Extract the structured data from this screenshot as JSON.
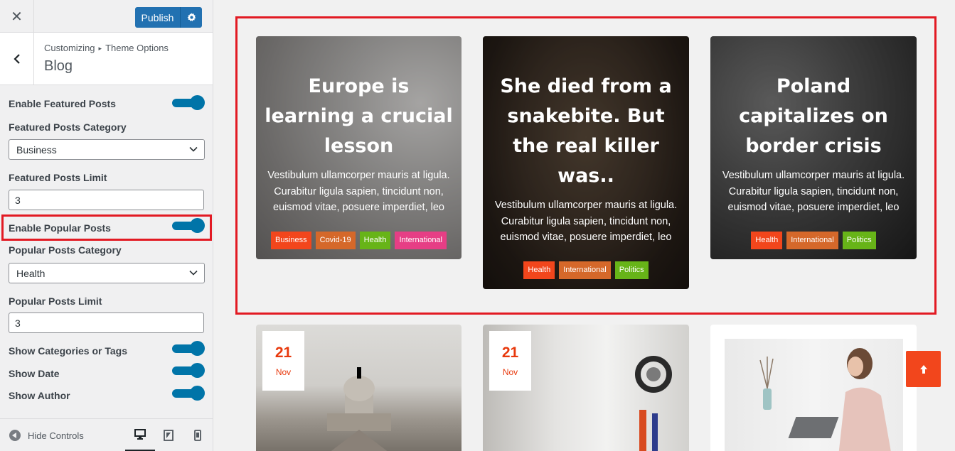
{
  "topbar": {
    "close_icon": "close-icon",
    "publish_label": "Publish",
    "settings_icon": "gear-icon"
  },
  "section": {
    "breadcrumb_root": "Customizing",
    "breadcrumb_parent": "Theme Options",
    "title": "Blog"
  },
  "controls": {
    "featured_enable_label": "Enable Featured Posts",
    "featured_category_label": "Featured Posts Category",
    "featured_category_value": "Business",
    "featured_limit_label": "Featured Posts Limit",
    "featured_limit_value": "3",
    "popular_enable_label": "Enable Popular Posts",
    "popular_category_label": "Popular Posts Category",
    "popular_category_value": "Health",
    "popular_limit_label": "Popular Posts Limit",
    "popular_limit_value": "3",
    "show_categories_label": "Show Categories or Tags",
    "show_date_label": "Show Date",
    "show_author_label": "Show Author"
  },
  "footer": {
    "hide_controls_label": "Hide Controls",
    "devices": [
      "desktop-icon",
      "tablet-icon",
      "mobile-icon"
    ]
  },
  "featured_posts": [
    {
      "title": "Europe is learning a crucial lesson",
      "excerpt": "Vestibulum ullamcorper mauris at ligula. Curabitur ligula sapien, tincidunt non, euismod vitae, posuere imperdiet, leo",
      "tags": [
        {
          "label": "Business",
          "color": "#f2461c"
        },
        {
          "label": "Covid-19",
          "color": "#d5682a"
        },
        {
          "label": "Health",
          "color": "#67b418"
        },
        {
          "label": "International",
          "color": "#e63e85"
        }
      ]
    },
    {
      "title": "She died from a snakebite. But the real killer was..",
      "excerpt": "Vestibulum ullamcorper mauris at ligula. Curabitur ligula sapien, tincidunt non, euismod vitae, posuere imperdiet, leo",
      "tags": [
        {
          "label": "Health",
          "color": "#f2461c"
        },
        {
          "label": "International",
          "color": "#d5682a"
        },
        {
          "label": "Politics",
          "color": "#67b418"
        }
      ]
    },
    {
      "title": "Poland capitalizes on border crisis",
      "excerpt": "Vestibulum ullamcorper mauris at ligula. Curabitur ligula sapien, tincidunt non, euismod vitae, posuere imperdiet, leo",
      "tags": [
        {
          "label": "Health",
          "color": "#f2461c"
        },
        {
          "label": "International",
          "color": "#d5682a"
        },
        {
          "label": "Politics",
          "color": "#67b418"
        }
      ]
    }
  ],
  "recent_posts": [
    {
      "day": "21",
      "month": "Nov"
    },
    {
      "day": "21",
      "month": "Nov"
    }
  ],
  "accent_color": "#0074a8",
  "highlight_color": "#e21a23"
}
